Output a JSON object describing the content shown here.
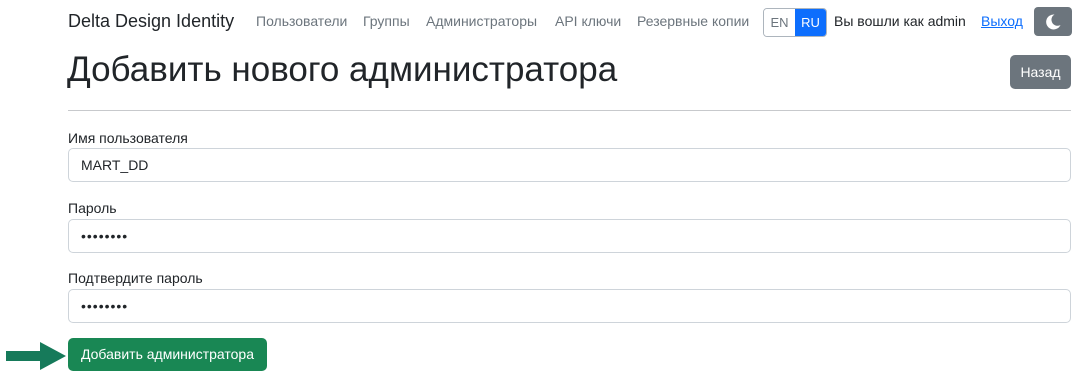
{
  "navbar": {
    "brand": "Delta Design Identity",
    "links": {
      "users": "Пользователи",
      "groups": "Группы",
      "admins": "Администраторы",
      "api_keys": "API ключи",
      "backups": "Резервные копии"
    },
    "languages": {
      "en": "EN",
      "ru": "RU",
      "active": "RU"
    },
    "logged_in_text": "Вы вошли как admin",
    "logout": "Выход",
    "theme_icon": "moon-icon"
  },
  "page": {
    "title": "Добавить нового администратора",
    "back_button": "Назад"
  },
  "form": {
    "username": {
      "label": "Имя пользователя",
      "value": "MART_DD"
    },
    "password": {
      "label": "Пароль",
      "value": "••••••••"
    },
    "confirm_password": {
      "label": "Подтвердите пароль",
      "value": "••••••••"
    },
    "submit": "Добавить администратора"
  },
  "colors": {
    "primary": "#0d6efd",
    "secondary": "#6c757d",
    "success": "#198754",
    "annotation_arrow": "#167a5a"
  }
}
